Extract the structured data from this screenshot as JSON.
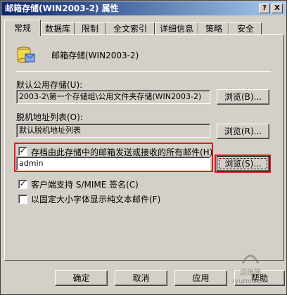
{
  "window": {
    "title": "邮箱存储(WIN2003-2) 属性",
    "help_glyph": "?",
    "close_glyph": "X"
  },
  "tabs": [
    {
      "label": "常规"
    },
    {
      "label": "数据库"
    },
    {
      "label": "限制"
    },
    {
      "label": "全文索引"
    },
    {
      "label": "详细信息"
    },
    {
      "label": "策略"
    },
    {
      "label": "安全"
    }
  ],
  "general": {
    "store_name": "邮箱存储(WIN2003-2)",
    "public_store_label": "默认公用存储(U):",
    "public_store_value": "2003-2\\第一个存储组\\公用文件夹存储(WIN2003-2)",
    "browse_b_label": "浏览(B)...",
    "offline_list_label": "脱机地址列表(O):",
    "offline_list_value": "默认脱机地址列表",
    "browse_r_label": "浏览(R)...",
    "archive_checkbox_label": "存档由此存储中的邮箱发送或接收的所有邮件(H)",
    "archive_checked": true,
    "archive_value": "admin",
    "browse_s_label": "浏览(S)...",
    "smime_label": "客户端支持 S/MIME 签名(C)",
    "smime_checked": true,
    "fixed_font_label": "以固定大小字体显示纯文本邮件(F)",
    "fixed_font_checked": false,
    "check_glyph": "✓"
  },
  "footer": {
    "ok_label": "确定",
    "cancel_label": "取消",
    "apply_label": "应用",
    "help_label": "帮助"
  },
  "watermark": {
    "line1": "运维网",
    "line2": "iyunv.com"
  }
}
